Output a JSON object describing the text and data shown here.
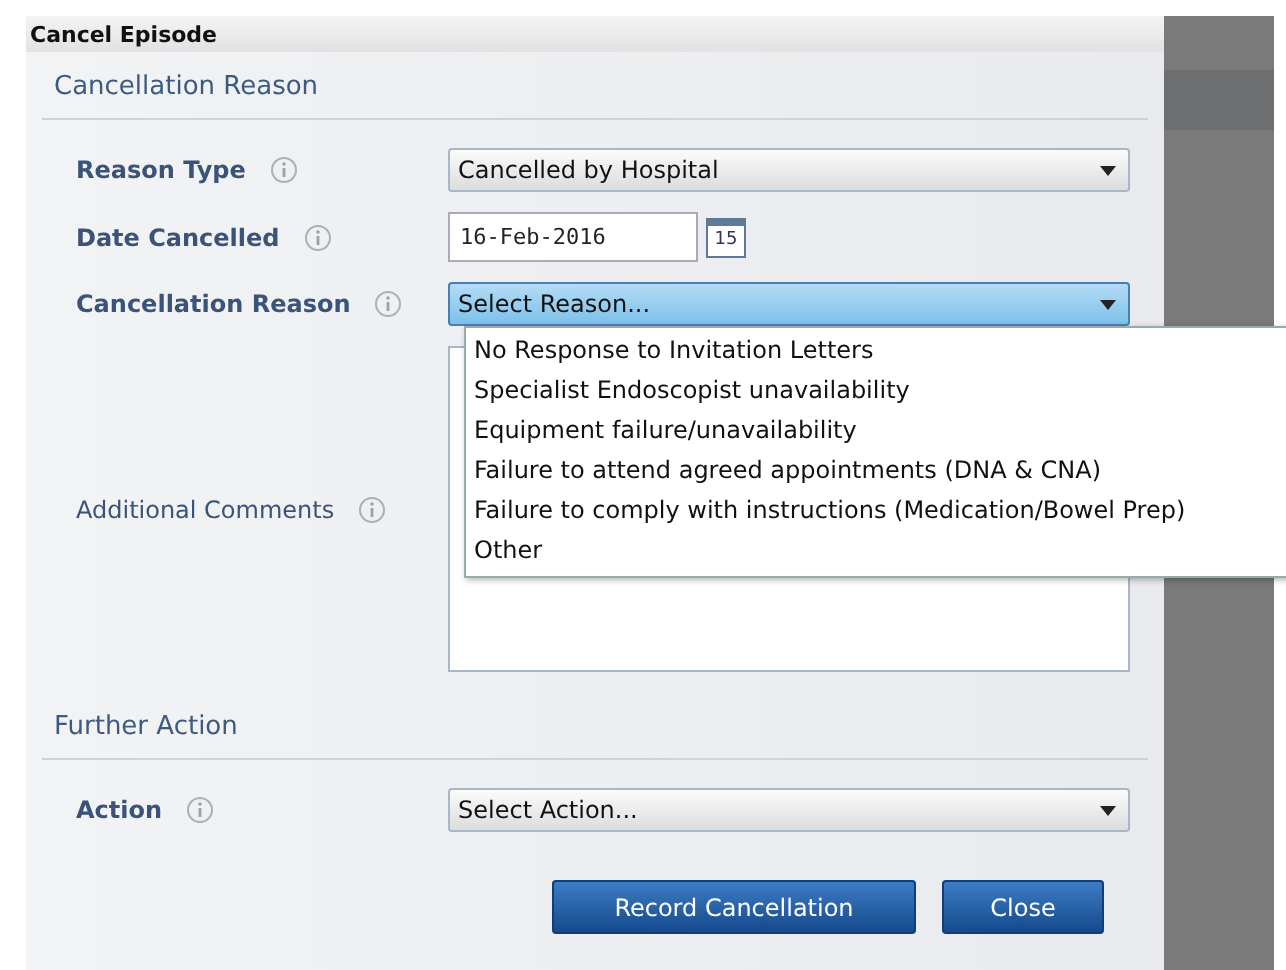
{
  "dialog": {
    "title": "Cancel Episode"
  },
  "sections": [
    {
      "heading": "Cancellation Reason",
      "fields": [
        {
          "kind": "select",
          "label": "Reason Type",
          "value": "Cancelled by Hospital",
          "expanded": false
        },
        {
          "kind": "date",
          "label": "Date Cancelled",
          "value": "16-Feb-2016",
          "calendar_day": "15"
        },
        {
          "kind": "select",
          "label": "Cancellation Reason",
          "value": "Select Reason...",
          "expanded": true,
          "options": [
            "No Response to Invitation Letters",
            "Specialist Endoscopist unavailability",
            "Equipment failure/unavailability",
            "Failure to attend agreed appointments (DNA & CNA)",
            "Failure to comply with instructions (Medication/Bowel Prep)",
            "Other"
          ]
        },
        {
          "kind": "textarea",
          "label": "Additional Comments"
        }
      ]
    },
    {
      "heading": "Further Action",
      "fields": [
        {
          "kind": "select",
          "label": "Action",
          "value": "Select Action...",
          "expanded": false
        }
      ]
    }
  ],
  "buttons": [
    "Record Cancellation",
    "Close"
  ]
}
